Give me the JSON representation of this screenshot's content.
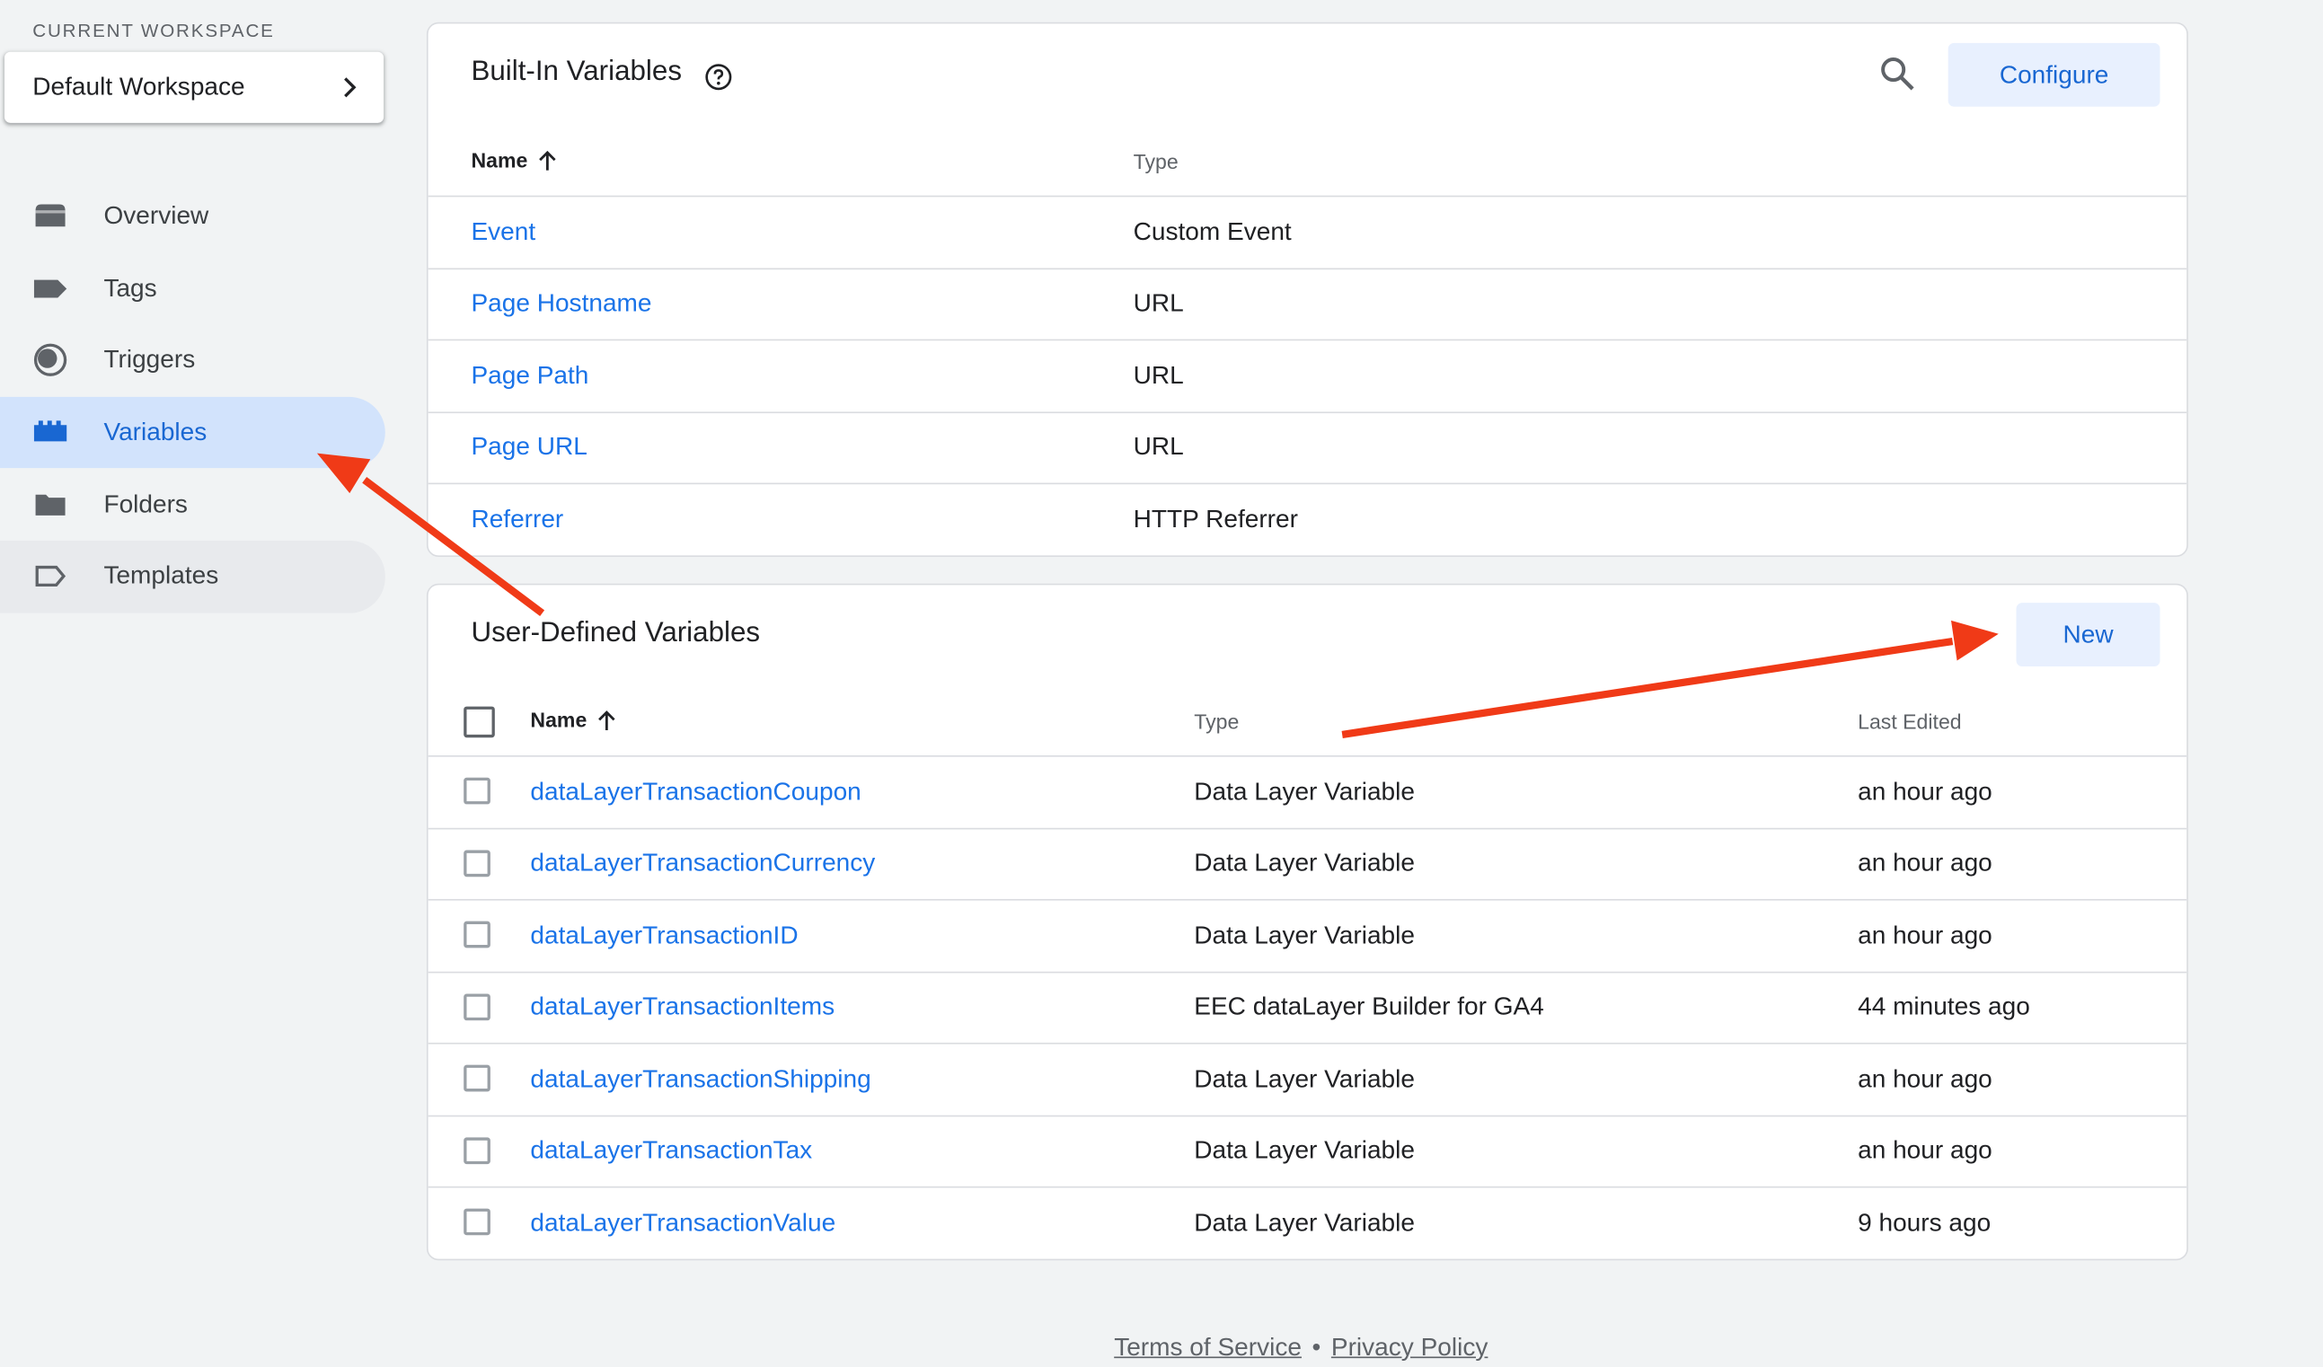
{
  "sidebar": {
    "workspace_label": "CURRENT WORKSPACE",
    "workspace_name": "Default Workspace",
    "items": [
      {
        "label": "Overview",
        "icon": "overview-icon"
      },
      {
        "label": "Tags",
        "icon": "tag-icon"
      },
      {
        "label": "Triggers",
        "icon": "trigger-icon"
      },
      {
        "label": "Variables",
        "icon": "variables-icon",
        "active": true
      },
      {
        "label": "Folders",
        "icon": "folder-icon"
      },
      {
        "label": "Templates",
        "icon": "template-icon"
      }
    ]
  },
  "builtin": {
    "title": "Built-In Variables",
    "configure_label": "Configure",
    "col_name": "Name",
    "col_type": "Type",
    "rows": [
      {
        "name": "Event",
        "type": "Custom Event"
      },
      {
        "name": "Page Hostname",
        "type": "URL"
      },
      {
        "name": "Page Path",
        "type": "URL"
      },
      {
        "name": "Page URL",
        "type": "URL"
      },
      {
        "name": "Referrer",
        "type": "HTTP Referrer"
      }
    ]
  },
  "userdef": {
    "title": "User-Defined Variables",
    "new_label": "New",
    "col_name": "Name",
    "col_type": "Type",
    "col_edited": "Last Edited",
    "rows": [
      {
        "name": "dataLayerTransactionCoupon",
        "type": "Data Layer Variable",
        "edited": "an hour ago"
      },
      {
        "name": "dataLayerTransactionCurrency",
        "type": "Data Layer Variable",
        "edited": "an hour ago"
      },
      {
        "name": "dataLayerTransactionID",
        "type": "Data Layer Variable",
        "edited": "an hour ago"
      },
      {
        "name": "dataLayerTransactionItems",
        "type": "EEC dataLayer Builder for GA4",
        "edited": "44 minutes ago"
      },
      {
        "name": "dataLayerTransactionShipping",
        "type": "Data Layer Variable",
        "edited": "an hour ago"
      },
      {
        "name": "dataLayerTransactionTax",
        "type": "Data Layer Variable",
        "edited": "an hour ago"
      },
      {
        "name": "dataLayerTransactionValue",
        "type": "Data Layer Variable",
        "edited": "9 hours ago"
      }
    ]
  },
  "footer": {
    "terms": "Terms of Service",
    "privacy": "Privacy Policy",
    "separator": "•"
  },
  "colors": {
    "accent": "#1a73e8",
    "active_nav": "#d2e3fc",
    "annotation_arrow": "#f03a17"
  }
}
